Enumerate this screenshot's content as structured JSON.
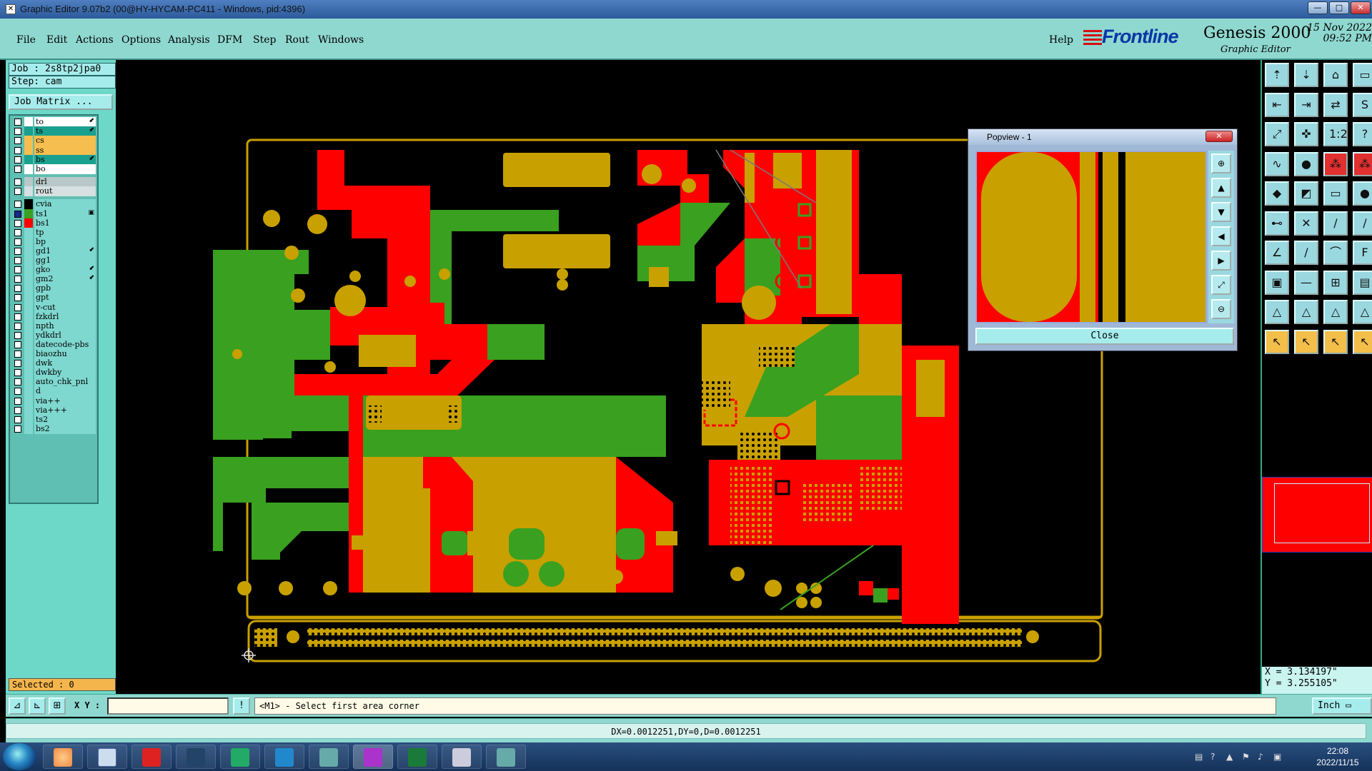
{
  "window": {
    "title": "Graphic Editor 9.07b2 (00@HY-HYCAM-PC411 - Windows, pid:4396)",
    "buttons": [
      "—",
      "□",
      "✕"
    ]
  },
  "menubar": {
    "items": [
      "File",
      "Edit",
      "Actions",
      "Options",
      "Analysis",
      "DFM",
      "Step",
      "Rout",
      "Windows"
    ],
    "help": "Help",
    "brand": "Frontline",
    "product": "Genesis 2000",
    "product_sub": "Graphic Editor",
    "date": "15 Nov 2022",
    "time": "09:52 PM"
  },
  "leftpanel": {
    "job": "Job : 2s8tp2jpa0",
    "step": "Step: cam",
    "job_matrix": "Job Matrix ...",
    "layers": [
      {
        "name": "to",
        "bg": "#ffffff",
        "swatch": "#ffffff",
        "flag": "⬋"
      },
      {
        "name": "ts",
        "bg": "#1aa08e",
        "swatch": "#1aa08e",
        "flag": "⬋"
      },
      {
        "name": "cs",
        "bg": "#f6be4e",
        "swatch": "#f6be4e",
        "flag": ""
      },
      {
        "name": "ss",
        "bg": "#f6be4e",
        "swatch": "#f6be4e",
        "flag": ""
      },
      {
        "name": "bs",
        "bg": "#1aa08e",
        "swatch": "#1aa08e",
        "flag": "⬋"
      },
      {
        "name": "bo",
        "bg": "#ffffff",
        "swatch": "#ffffff",
        "flag": ""
      },
      {
        "name": "drl",
        "bg": "#b8c8c8",
        "swatch": "#b8c8c8",
        "flag": ""
      },
      {
        "name": "rout",
        "bg": "#d6e0e0",
        "swatch": "#d6e0e0",
        "flag": ""
      },
      {
        "name": "cvia",
        "bg": "#7fd8d0",
        "swatch": "#000000",
        "flag": ""
      },
      {
        "name": "ts1",
        "bg": "#7fd8d0",
        "swatch": "#3aa020",
        "flag": "▣",
        "checked": true
      },
      {
        "name": "bs1",
        "bg": "#7fd8d0",
        "swatch": "#ff0000",
        "flag": ""
      },
      {
        "name": "tp",
        "bg": "#7fd8d0",
        "swatch": "#7fd8d0",
        "flag": ""
      },
      {
        "name": "bp",
        "bg": "#7fd8d0",
        "swatch": "#7fd8d0",
        "flag": ""
      },
      {
        "name": "gd1",
        "bg": "#7fd8d0",
        "swatch": "#7fd8d0",
        "flag": "⬋"
      },
      {
        "name": "gg1",
        "bg": "#7fd8d0",
        "swatch": "#7fd8d0",
        "flag": ""
      },
      {
        "name": "gko",
        "bg": "#7fd8d0",
        "swatch": "#7fd8d0",
        "flag": "⬋"
      },
      {
        "name": "gm2",
        "bg": "#7fd8d0",
        "swatch": "#7fd8d0",
        "flag": "⬋"
      },
      {
        "name": "gpb",
        "bg": "#7fd8d0",
        "swatch": "#7fd8d0",
        "flag": ""
      },
      {
        "name": "gpt",
        "bg": "#7fd8d0",
        "swatch": "#7fd8d0",
        "flag": ""
      },
      {
        "name": "v-cut",
        "bg": "#7fd8d0",
        "swatch": "#7fd8d0",
        "flag": ""
      },
      {
        "name": "fzkdrl",
        "bg": "#7fd8d0",
        "swatch": "#7fd8d0",
        "flag": ""
      },
      {
        "name": "npth",
        "bg": "#7fd8d0",
        "swatch": "#7fd8d0",
        "flag": ""
      },
      {
        "name": "ydkdrl",
        "bg": "#7fd8d0",
        "swatch": "#7fd8d0",
        "flag": ""
      },
      {
        "name": "datecode-pbs",
        "bg": "#7fd8d0",
        "swatch": "#7fd8d0",
        "flag": ""
      },
      {
        "name": "biaozhu",
        "bg": "#7fd8d0",
        "swatch": "#7fd8d0",
        "flag": ""
      },
      {
        "name": "dwk",
        "bg": "#7fd8d0",
        "swatch": "#7fd8d0",
        "flag": ""
      },
      {
        "name": "dwkby",
        "bg": "#7fd8d0",
        "swatch": "#7fd8d0",
        "flag": ""
      },
      {
        "name": "auto_chk_pnl",
        "bg": "#7fd8d0",
        "swatch": "#7fd8d0",
        "flag": ""
      },
      {
        "name": "d",
        "bg": "#7fd8d0",
        "swatch": "#7fd8d0",
        "flag": ""
      },
      {
        "name": "via++",
        "bg": "#7fd8d0",
        "swatch": "#7fd8d0",
        "flag": ""
      },
      {
        "name": "via+++",
        "bg": "#7fd8d0",
        "swatch": "#7fd8d0",
        "flag": ""
      },
      {
        "name": "ts2",
        "bg": "#7fd8d0",
        "swatch": "#7fd8d0",
        "flag": ""
      },
      {
        "name": "bs2",
        "bg": "#7fd8d0",
        "swatch": "#7fd8d0",
        "flag": ""
      }
    ],
    "selected": "Selected : 0"
  },
  "popview": {
    "title": "Popview - 1",
    "close_label": "Close"
  },
  "rightpanel": {
    "coord_x": "X = 3.134197\"",
    "coord_y": "Y = 3.255105\""
  },
  "statusbar": {
    "xy_label": "X Y :",
    "xy_value": "",
    "prompt": "<M1> - Select first area corner",
    "unit": "Inch ▭",
    "measure": "DX=0.0012251,DY=0,D=0.0012251"
  },
  "taskbar": {
    "time": "22:08",
    "date": "2022/11/15"
  },
  "colors": {
    "layer_top": "#3aa020",
    "layer_bottom": "#ff0000",
    "overlap": "#c8a000",
    "outline": "#c8a000"
  }
}
